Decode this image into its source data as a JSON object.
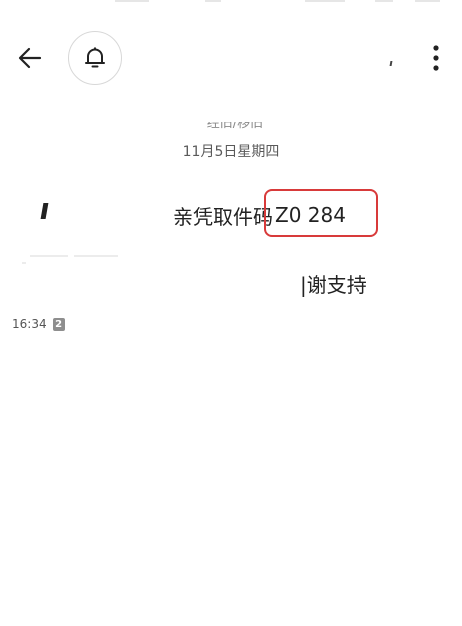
{
  "header": {
    "back_icon": "arrow-left-icon",
    "bell_icon": "bell-icon",
    "more_icon": "more-vertical-icon"
  },
  "thread": {
    "sender_fragment": "经旧/移旧",
    "date_label": "11月5日星期四"
  },
  "message": {
    "line1_prefix": "亲凭取件码",
    "pickup_code": "Z0  284",
    "line2": "|谢支持",
    "highlight_color": "#d83a3a"
  },
  "footer": {
    "timestamp": "16:34",
    "sim_badge": "2"
  }
}
